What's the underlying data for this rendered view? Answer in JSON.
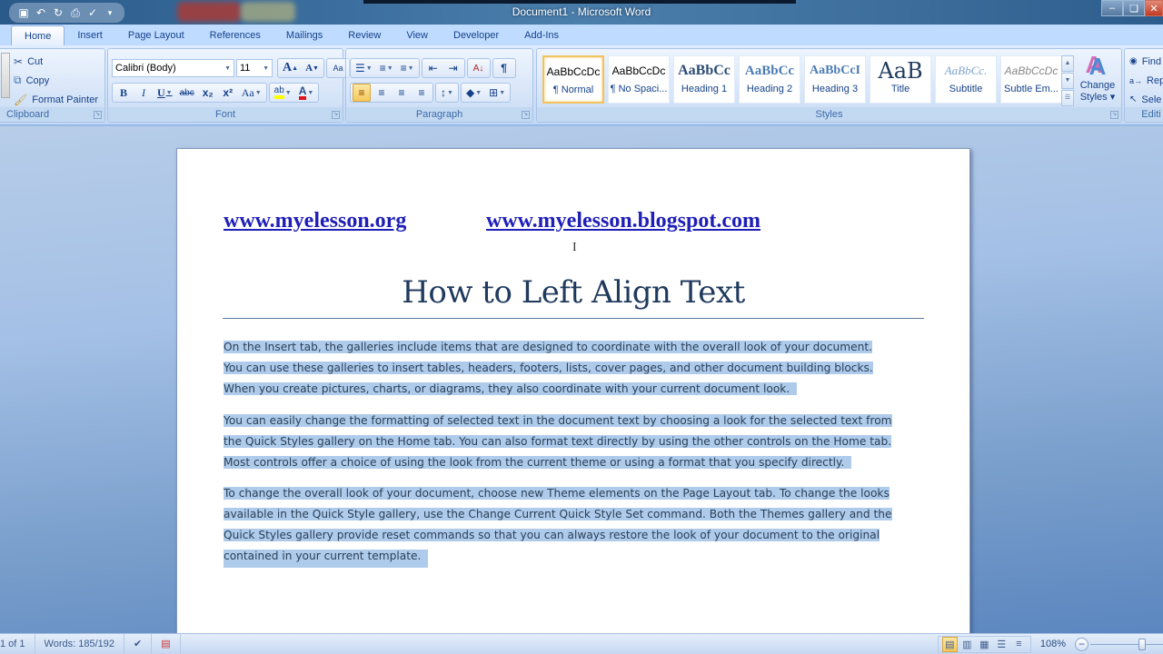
{
  "window": {
    "title": "Document1 - Microsoft Word",
    "controls": {
      "minimize": "–",
      "restore": "❏",
      "close": "✕"
    }
  },
  "quick_access": [
    {
      "icon": "save-icon",
      "glyph": "▣"
    },
    {
      "icon": "undo-icon",
      "glyph": "↶"
    },
    {
      "icon": "redo-icon",
      "glyph": "↻"
    },
    {
      "icon": "print-preview-icon",
      "glyph": "⎙"
    },
    {
      "icon": "spelling-icon",
      "glyph": "✓"
    },
    {
      "icon": "customize-dropdown-icon",
      "glyph": "▾"
    }
  ],
  "tabs": [
    {
      "label": "Home",
      "active": true
    },
    {
      "label": "Insert"
    },
    {
      "label": "Page Layout"
    },
    {
      "label": "References"
    },
    {
      "label": "Mailings"
    },
    {
      "label": "Review"
    },
    {
      "label": "View"
    },
    {
      "label": "Developer"
    },
    {
      "label": "Add-Ins"
    }
  ],
  "ribbon": {
    "clipboard": {
      "label": "Clipboard",
      "cut": "Cut",
      "copy": "Copy",
      "format_painter": "Format Painter"
    },
    "font": {
      "label": "Font",
      "font_name": "Calibri (Body)",
      "font_size": "11",
      "grow": "A",
      "shrink": "A",
      "clear": "Aa",
      "bold": "B",
      "italic": "I",
      "underline": "U",
      "strike": "abc",
      "subscript": "x₂",
      "superscript": "x²",
      "change_case": "Aa",
      "highlight": "ab",
      "font_color": "A",
      "highlight_color": "#ffff00",
      "font_color_value": "#e0151a"
    },
    "paragraph": {
      "label": "Paragraph",
      "bullets": "☰",
      "numbering": "≡",
      "multilevel": "≡",
      "decrease_indent": "⇤",
      "increase_indent": "⇥",
      "sort": "A↓",
      "show_marks": "¶",
      "align_left": "≡",
      "center": "≡",
      "align_right": "≡",
      "justify": "≡",
      "line_spacing": "↕",
      "shading": "◆",
      "borders": "⊞",
      "active_alignment": "left"
    },
    "styles": {
      "label": "Styles",
      "items": [
        {
          "sample": "AaBbCcDc",
          "name": "¶ Normal",
          "selected": true
        },
        {
          "sample": "AaBbCcDc",
          "name": "¶ No Spaci..."
        },
        {
          "sample": "AaBbCc",
          "name": "Heading 1"
        },
        {
          "sample": "AaBbCc",
          "name": "Heading 2"
        },
        {
          "sample": "AaBbCcI",
          "name": "Heading 3"
        },
        {
          "sample": "AaB",
          "name": "Title"
        },
        {
          "sample": "AaBbCc.",
          "name": "Subtitle"
        },
        {
          "sample": "AaBbCcDc",
          "name": "Subtle Em..."
        }
      ],
      "change_styles": "Change Styles",
      "change_styles_line1": "Change",
      "change_styles_line2": "Styles ▾"
    },
    "editing": {
      "label": "Editi",
      "find": "Find",
      "replace": "Rep",
      "select": "Sele"
    }
  },
  "document": {
    "links": [
      "www.myelesson.org",
      "www.myelesson.blogspot.com"
    ],
    "title": "How to Left Align Text",
    "paragraphs": [
      [
        "On the Insert tab, the galleries include items that are designed to coordinate with the overall look of your document.",
        "You can use these galleries to insert tables, headers, footers, lists, cover pages, and other document building blocks.",
        "When you create pictures, charts, or diagrams, they also coordinate with your current document look."
      ],
      [
        "You can easily change the formatting of selected text in the document text by choosing a look for the selected text from",
        "the Quick Styles gallery on the Home tab. You can also format text directly by using the other controls on the Home tab.",
        "Most controls offer a choice of using the look from the current theme or using a format that you specify directly."
      ],
      [
        "To change the overall look of your document, choose new Theme elements on the Page Layout tab. To change the looks",
        "available in the Quick Style gallery, use the Change Current Quick Style Set command. Both the Themes gallery and the",
        "Quick Styles gallery provide reset commands so that you can always restore the look of your document to the original",
        "contained in your current template."
      ]
    ],
    "selection_color": "#aecbec"
  },
  "statusbar": {
    "page": "1 of 1",
    "words": "Words: 185/192",
    "proofing_icon": "✔",
    "language_icon": "▤",
    "views": [
      {
        "name": "print-layout",
        "glyph": "▤",
        "active": true
      },
      {
        "name": "full-screen-reading",
        "glyph": "▥"
      },
      {
        "name": "web-layout",
        "glyph": "▦"
      },
      {
        "name": "outline",
        "glyph": "☰"
      },
      {
        "name": "draft",
        "glyph": "≡"
      }
    ],
    "zoom": "108%",
    "zoom_out": "−"
  }
}
